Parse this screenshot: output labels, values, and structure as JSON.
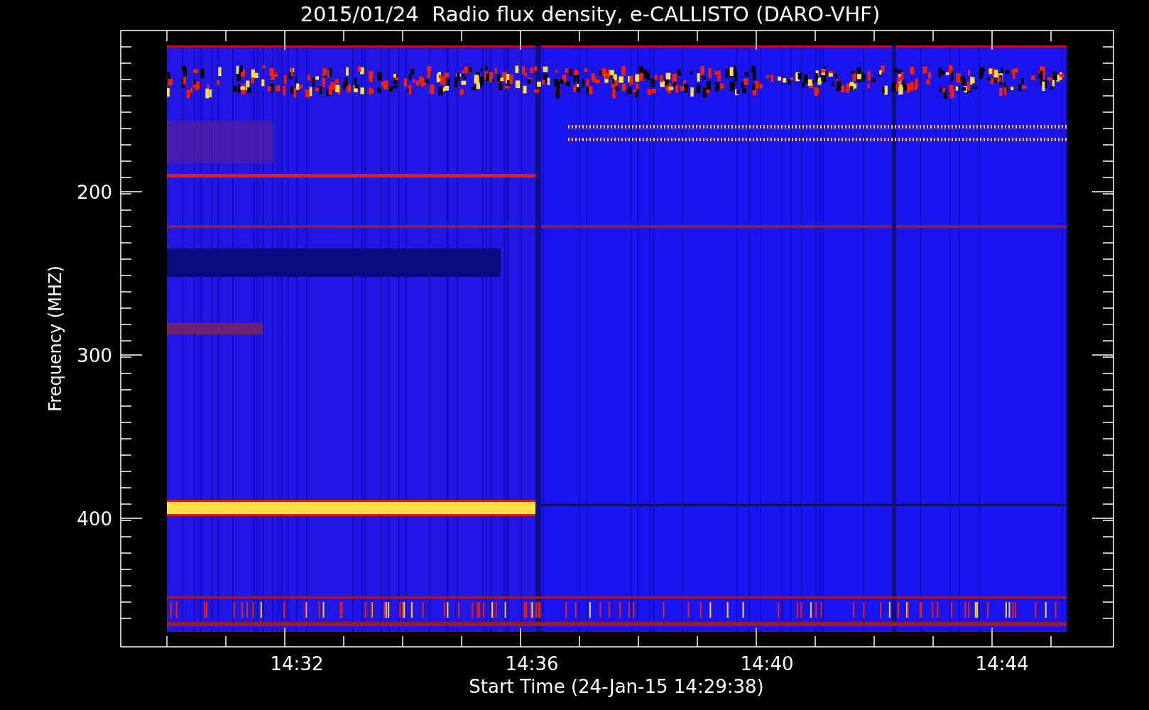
{
  "title": "2015/01/24  Radio flux density, e-CALLISTO (DARO-VHF)",
  "plot": {
    "ylabel": "Frequency (MHZ)",
    "xlabel": "Start Time (24-Jan-15 14:29:38)",
    "yticks": [
      "200",
      "300",
      "400"
    ],
    "xticks": [
      "14:32",
      "14:36",
      "14:40",
      "14:44"
    ]
  }
}
